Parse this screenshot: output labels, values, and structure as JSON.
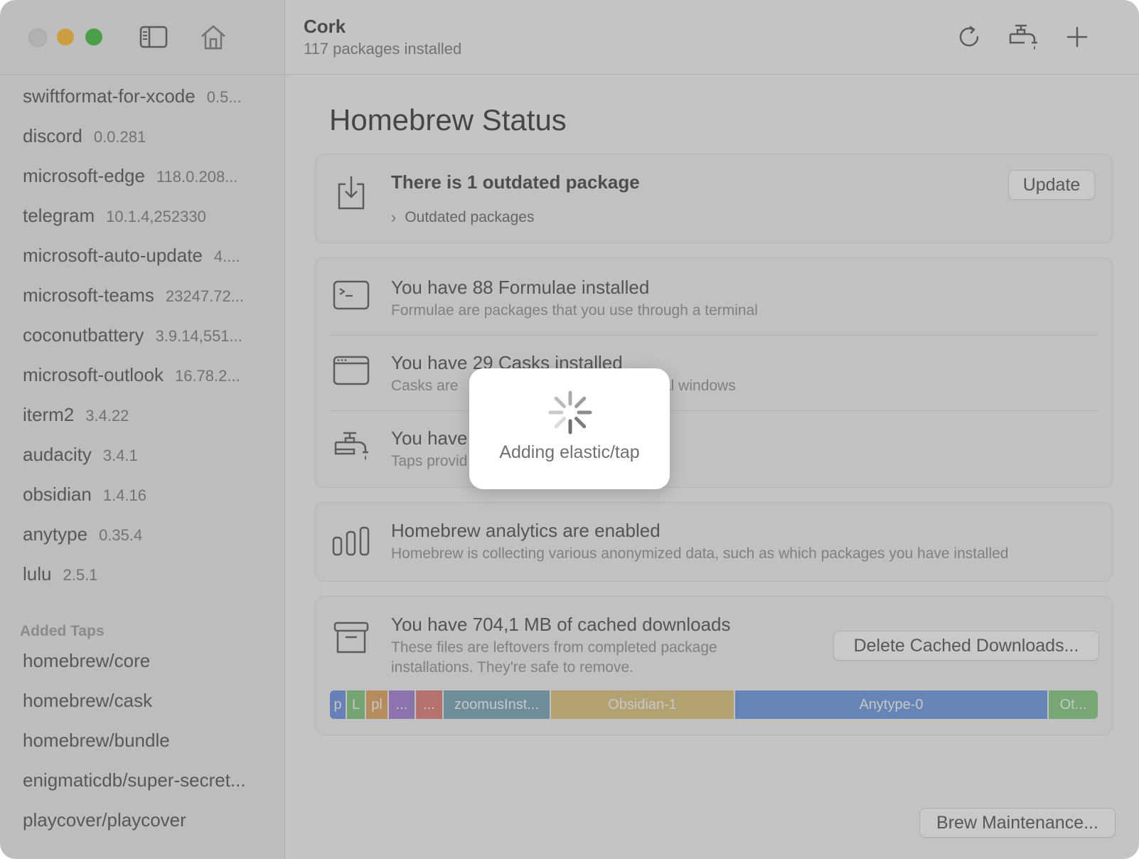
{
  "window": {
    "app_name": "Cork",
    "subtitle": "117 packages installed"
  },
  "sidebar": {
    "packages": [
      {
        "name": "swiftformat-for-xcode",
        "version": "0.5..."
      },
      {
        "name": "discord",
        "version": "0.0.281"
      },
      {
        "name": "microsoft-edge",
        "version": "118.0.208..."
      },
      {
        "name": "telegram",
        "version": "10.1.4,252330"
      },
      {
        "name": "microsoft-auto-update",
        "version": "4...."
      },
      {
        "name": "microsoft-teams",
        "version": "23247.72..."
      },
      {
        "name": "coconutbattery",
        "version": "3.9.14,551..."
      },
      {
        "name": "microsoft-outlook",
        "version": "16.78.2..."
      },
      {
        "name": "iterm2",
        "version": "3.4.22"
      },
      {
        "name": "audacity",
        "version": "3.4.1"
      },
      {
        "name": "obsidian",
        "version": "1.4.16"
      },
      {
        "name": "anytype",
        "version": "0.35.4"
      },
      {
        "name": "lulu",
        "version": "2.5.1"
      }
    ],
    "taps_header": "Added Taps",
    "taps": [
      "homebrew/core",
      "homebrew/cask",
      "homebrew/bundle",
      "enigmaticdb/super-secret...",
      "playcover/playcover"
    ]
  },
  "main": {
    "heading": "Homebrew Status",
    "outdated": {
      "title": "There is 1 outdated package",
      "disclosure_label": "Outdated packages",
      "update_button": "Update"
    },
    "formulae": {
      "title": "You have 88 Formulae installed",
      "subtitle": "Formulae are packages that you use through a terminal"
    },
    "casks": {
      "title": "You have 29 Casks installed",
      "subtitle_left": "Casks are",
      "subtitle_right": "al windows"
    },
    "taps": {
      "title": "You have",
      "subtitle": "Taps provid"
    },
    "analytics": {
      "title": "Homebrew analytics are enabled",
      "subtitle": "Homebrew is collecting various anonymized data, such as which packages you have installed"
    },
    "cache": {
      "title": "You have 704,1 MB of cached downloads",
      "subtitle_line1": "These files are leftovers from completed package",
      "subtitle_line2": "installations. They're safe to remove.",
      "delete_button": "Delete Cached Downloads...",
      "segments": [
        {
          "label": "p",
          "share": 0.022,
          "color": "#7d9bdc"
        },
        {
          "label": "L",
          "share": 0.025,
          "color": "#8cc48c"
        },
        {
          "label": "pl",
          "share": 0.03,
          "color": "#dba872"
        },
        {
          "label": "...",
          "share": 0.035,
          "color": "#a98bd0"
        },
        {
          "label": "...",
          "share": 0.036,
          "color": "#d98a86"
        },
        {
          "label": "zoomusInst...",
          "share": 0.14,
          "color": "#86a9b8"
        },
        {
          "label": "Obsidian-1",
          "share": 0.24,
          "color": "#d6c389"
        },
        {
          "label": "Anytype-0",
          "share": 0.408,
          "color": "#7c9fdc"
        },
        {
          "label": "Ot...",
          "share": 0.064,
          "color": "#8fc98c"
        }
      ]
    },
    "maintenance_button": "Brew Maintenance..."
  },
  "sheet": {
    "message": "Adding elastic/tap"
  }
}
